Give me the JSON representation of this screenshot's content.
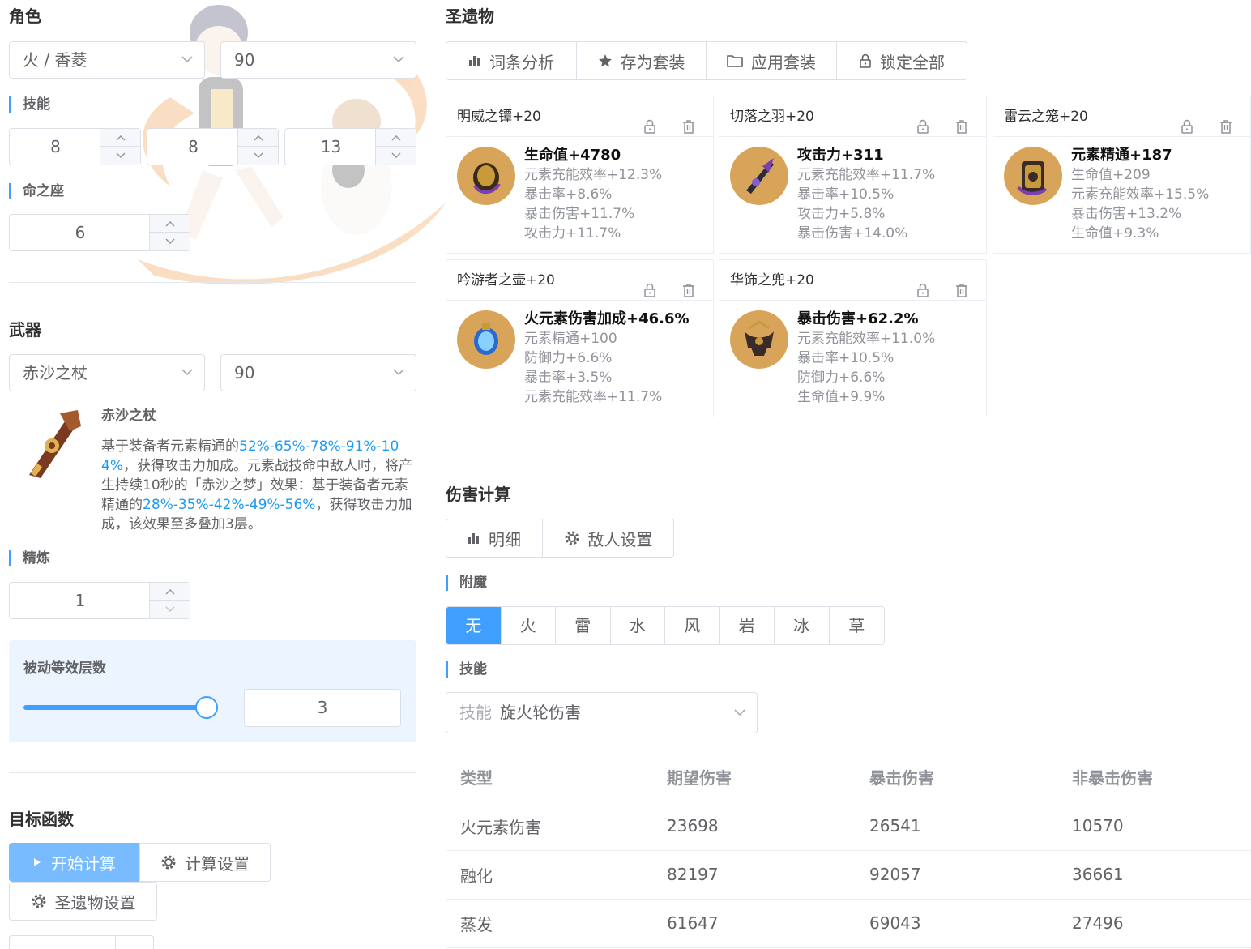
{
  "character": {
    "title": "角色",
    "select_value": "火 / 香菱",
    "level_value": "90",
    "skills_label": "技能",
    "skill_levels": [
      "8",
      "8",
      "13"
    ],
    "constellation_label": "命之座",
    "constellation_value": "6"
  },
  "weapon": {
    "title": "武器",
    "select_value": "赤沙之杖",
    "level_value": "90",
    "name": "赤沙之杖",
    "desc_parts": [
      {
        "text": "基于装备者元素精通的",
        "hl": false
      },
      {
        "text": "52%-65%-78%-91%-104%",
        "hl": true
      },
      {
        "text": "，获得攻击力加成。元素战技命中敌人时，将产生持续10秒的「赤沙之梦」效果：基于装备者元素精通的",
        "hl": false
      },
      {
        "text": "28%-35%-42%-49%-56%",
        "hl": true
      },
      {
        "text": "，获得攻击力加成，该效果至多叠加3层。",
        "hl": false
      }
    ],
    "refine_label": "精炼",
    "refine_value": "1",
    "passive_label": "被动等效层数",
    "passive_value": "3",
    "passive_fraction": 1.0
  },
  "target": {
    "title": "目标函数",
    "start_label": "开始计算",
    "settings_label": "计算设置",
    "artifact_settings_label": "圣遗物设置"
  },
  "artifacts": {
    "title": "圣遗物",
    "toolbar": [
      "词条分析",
      "存为套装",
      "应用套装",
      "锁定全部"
    ],
    "cards": [
      {
        "name": "明威之镡+20",
        "main": "生命值+4780",
        "subs": [
          "元素充能效率+12.3%",
          "暴击率+8.6%",
          "暴击伤害+11.7%",
          "攻击力+11.7%"
        ]
      },
      {
        "name": "切落之羽+20",
        "main": "攻击力+311",
        "subs": [
          "元素充能效率+11.7%",
          "暴击率+10.5%",
          "攻击力+5.8%",
          "暴击伤害+14.0%"
        ]
      },
      {
        "name": "雷云之笼+20",
        "main": "元素精通+187",
        "subs": [
          "生命值+209",
          "元素充能效率+15.5%",
          "暴击伤害+13.2%",
          "生命值+9.3%"
        ]
      },
      {
        "name": "吟游者之壶+20",
        "main": "火元素伤害加成+46.6%",
        "subs": [
          "元素精通+100",
          "防御力+6.6%",
          "暴击率+3.5%",
          "元素充能效率+11.7%"
        ]
      },
      {
        "name": "华饰之兜+20",
        "main": "暴击伤害+62.2%",
        "subs": [
          "元素充能效率+11.0%",
          "暴击率+10.5%",
          "防御力+6.6%",
          "生命值+9.9%"
        ]
      }
    ]
  },
  "damage": {
    "title": "伤害计算",
    "tabs": [
      "明细",
      "敌人设置"
    ],
    "infusion_label": "附魔",
    "elements": [
      "无",
      "火",
      "雷",
      "水",
      "风",
      "岩",
      "冰",
      "草"
    ],
    "active_element": "无",
    "skill_label": "技能",
    "skill_prefix": "技能",
    "skill_value": "旋火轮伤害",
    "table": {
      "headers": [
        "类型",
        "期望伤害",
        "暴击伤害",
        "非暴击伤害"
      ],
      "rows": [
        [
          "火元素伤害",
          "23698",
          "26541",
          "10570"
        ],
        [
          "融化",
          "82197",
          "92057",
          "36661"
        ],
        [
          "蒸发",
          "61647",
          "69043",
          "27496"
        ]
      ]
    }
  },
  "colors": {
    "accent": "#409eff",
    "highlight": "#1e9bf0"
  }
}
